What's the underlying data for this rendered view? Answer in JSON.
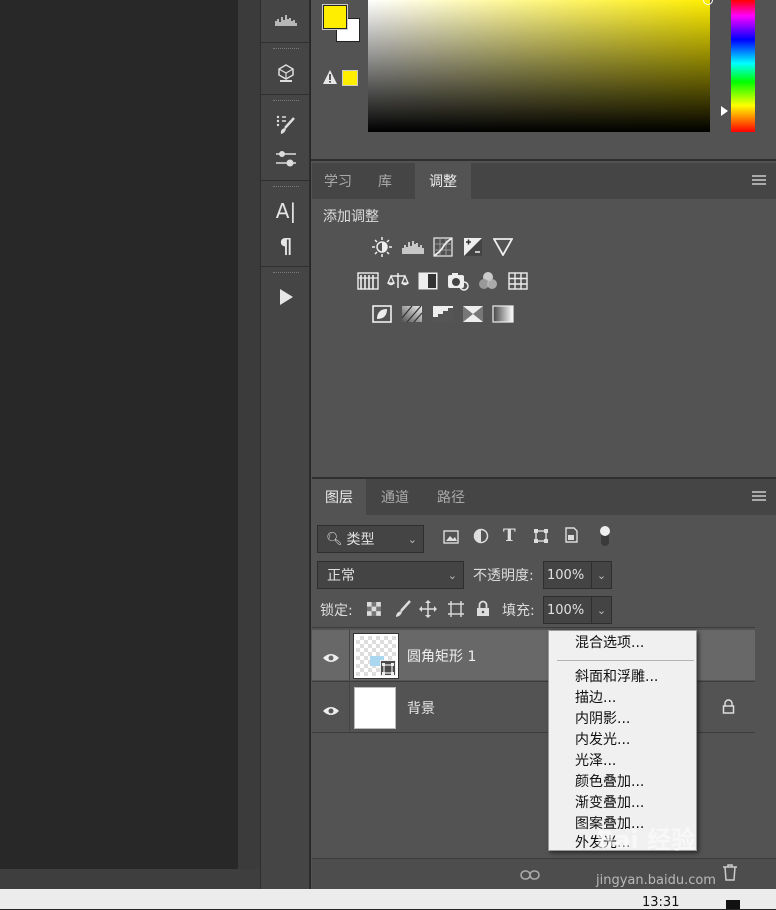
{
  "color_panel": {
    "foreground": "#ffee00",
    "background": "#ffffff",
    "gamut_warning_color": "#ffee00"
  },
  "toolstrip": {
    "tools": [
      "histogram-icon",
      "3d-cube-icon",
      "brush-settings-icon",
      "properties-sliders-icon",
      "character-icon",
      "paragraph-icon",
      "play-action-icon"
    ],
    "character_glyph": "A|",
    "paragraph_glyph": "¶"
  },
  "adjust_panel": {
    "tabs": [
      {
        "label": "学习",
        "active": false
      },
      {
        "label": "库",
        "active": false
      },
      {
        "label": "调整",
        "active": true
      }
    ],
    "title": "添加调整",
    "icon_rows": [
      [
        "brightness-contrast-icon",
        "levels-icon",
        "curves-icon",
        "exposure-icon",
        "gradient-triangle-icon"
      ],
      [
        "hue-saturation-icon",
        "color-balance-icon",
        "black-white-icon",
        "photo-filter-icon",
        "channel-mixer-icon",
        "color-lookup-icon"
      ],
      [
        "invert-icon",
        "posterize-icon",
        "threshold-icon",
        "selective-color-icon",
        "gradient-map-icon"
      ]
    ]
  },
  "layers_panel": {
    "tabs": [
      {
        "label": "图层",
        "active": true
      },
      {
        "label": "通道",
        "active": false
      },
      {
        "label": "路径",
        "active": false
      }
    ],
    "filter_kind": "类型",
    "blend_mode": "正常",
    "opacity_label": "不透明度:",
    "opacity_value": "100%",
    "lock_label": "锁定:",
    "fill_label": "填充:",
    "fill_value": "100%",
    "layers": [
      {
        "name": "圆角矩形 1",
        "selected": true,
        "visible": true,
        "locked": false
      },
      {
        "name": "背景",
        "selected": false,
        "visible": true,
        "locked": true
      }
    ]
  },
  "context_menu": {
    "items": [
      "混合选项...",
      "斜面和浮雕...",
      "描边...",
      "内阴影...",
      "内发光...",
      "光泽...",
      "颜色叠加...",
      "渐变叠加...",
      "图案叠加...",
      "外发光..."
    ]
  },
  "taskbar": {
    "clock": "13:31"
  },
  "watermark": {
    "brand": "Bai 经验",
    "url": "jingyan.baidu.com"
  }
}
